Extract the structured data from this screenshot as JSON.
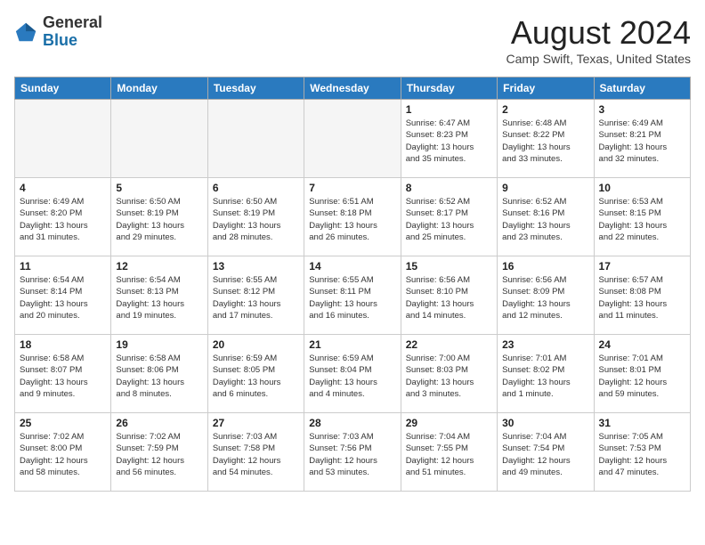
{
  "header": {
    "logo": {
      "general": "General",
      "blue": "Blue"
    },
    "title": "August 2024",
    "location": "Camp Swift, Texas, United States"
  },
  "weekdays": [
    "Sunday",
    "Monday",
    "Tuesday",
    "Wednesday",
    "Thursday",
    "Friday",
    "Saturday"
  ],
  "weeks": [
    [
      {
        "day": "",
        "info": ""
      },
      {
        "day": "",
        "info": ""
      },
      {
        "day": "",
        "info": ""
      },
      {
        "day": "",
        "info": ""
      },
      {
        "day": "1",
        "info": "Sunrise: 6:47 AM\nSunset: 8:23 PM\nDaylight: 13 hours\nand 35 minutes."
      },
      {
        "day": "2",
        "info": "Sunrise: 6:48 AM\nSunset: 8:22 PM\nDaylight: 13 hours\nand 33 minutes."
      },
      {
        "day": "3",
        "info": "Sunrise: 6:49 AM\nSunset: 8:21 PM\nDaylight: 13 hours\nand 32 minutes."
      }
    ],
    [
      {
        "day": "4",
        "info": "Sunrise: 6:49 AM\nSunset: 8:20 PM\nDaylight: 13 hours\nand 31 minutes."
      },
      {
        "day": "5",
        "info": "Sunrise: 6:50 AM\nSunset: 8:19 PM\nDaylight: 13 hours\nand 29 minutes."
      },
      {
        "day": "6",
        "info": "Sunrise: 6:50 AM\nSunset: 8:19 PM\nDaylight: 13 hours\nand 28 minutes."
      },
      {
        "day": "7",
        "info": "Sunrise: 6:51 AM\nSunset: 8:18 PM\nDaylight: 13 hours\nand 26 minutes."
      },
      {
        "day": "8",
        "info": "Sunrise: 6:52 AM\nSunset: 8:17 PM\nDaylight: 13 hours\nand 25 minutes."
      },
      {
        "day": "9",
        "info": "Sunrise: 6:52 AM\nSunset: 8:16 PM\nDaylight: 13 hours\nand 23 minutes."
      },
      {
        "day": "10",
        "info": "Sunrise: 6:53 AM\nSunset: 8:15 PM\nDaylight: 13 hours\nand 22 minutes."
      }
    ],
    [
      {
        "day": "11",
        "info": "Sunrise: 6:54 AM\nSunset: 8:14 PM\nDaylight: 13 hours\nand 20 minutes."
      },
      {
        "day": "12",
        "info": "Sunrise: 6:54 AM\nSunset: 8:13 PM\nDaylight: 13 hours\nand 19 minutes."
      },
      {
        "day": "13",
        "info": "Sunrise: 6:55 AM\nSunset: 8:12 PM\nDaylight: 13 hours\nand 17 minutes."
      },
      {
        "day": "14",
        "info": "Sunrise: 6:55 AM\nSunset: 8:11 PM\nDaylight: 13 hours\nand 16 minutes."
      },
      {
        "day": "15",
        "info": "Sunrise: 6:56 AM\nSunset: 8:10 PM\nDaylight: 13 hours\nand 14 minutes."
      },
      {
        "day": "16",
        "info": "Sunrise: 6:56 AM\nSunset: 8:09 PM\nDaylight: 13 hours\nand 12 minutes."
      },
      {
        "day": "17",
        "info": "Sunrise: 6:57 AM\nSunset: 8:08 PM\nDaylight: 13 hours\nand 11 minutes."
      }
    ],
    [
      {
        "day": "18",
        "info": "Sunrise: 6:58 AM\nSunset: 8:07 PM\nDaylight: 13 hours\nand 9 minutes."
      },
      {
        "day": "19",
        "info": "Sunrise: 6:58 AM\nSunset: 8:06 PM\nDaylight: 13 hours\nand 8 minutes."
      },
      {
        "day": "20",
        "info": "Sunrise: 6:59 AM\nSunset: 8:05 PM\nDaylight: 13 hours\nand 6 minutes."
      },
      {
        "day": "21",
        "info": "Sunrise: 6:59 AM\nSunset: 8:04 PM\nDaylight: 13 hours\nand 4 minutes."
      },
      {
        "day": "22",
        "info": "Sunrise: 7:00 AM\nSunset: 8:03 PM\nDaylight: 13 hours\nand 3 minutes."
      },
      {
        "day": "23",
        "info": "Sunrise: 7:01 AM\nSunset: 8:02 PM\nDaylight: 13 hours\nand 1 minute."
      },
      {
        "day": "24",
        "info": "Sunrise: 7:01 AM\nSunset: 8:01 PM\nDaylight: 12 hours\nand 59 minutes."
      }
    ],
    [
      {
        "day": "25",
        "info": "Sunrise: 7:02 AM\nSunset: 8:00 PM\nDaylight: 12 hours\nand 58 minutes."
      },
      {
        "day": "26",
        "info": "Sunrise: 7:02 AM\nSunset: 7:59 PM\nDaylight: 12 hours\nand 56 minutes."
      },
      {
        "day": "27",
        "info": "Sunrise: 7:03 AM\nSunset: 7:58 PM\nDaylight: 12 hours\nand 54 minutes."
      },
      {
        "day": "28",
        "info": "Sunrise: 7:03 AM\nSunset: 7:56 PM\nDaylight: 12 hours\nand 53 minutes."
      },
      {
        "day": "29",
        "info": "Sunrise: 7:04 AM\nSunset: 7:55 PM\nDaylight: 12 hours\nand 51 minutes."
      },
      {
        "day": "30",
        "info": "Sunrise: 7:04 AM\nSunset: 7:54 PM\nDaylight: 12 hours\nand 49 minutes."
      },
      {
        "day": "31",
        "info": "Sunrise: 7:05 AM\nSunset: 7:53 PM\nDaylight: 12 hours\nand 47 minutes."
      }
    ]
  ]
}
